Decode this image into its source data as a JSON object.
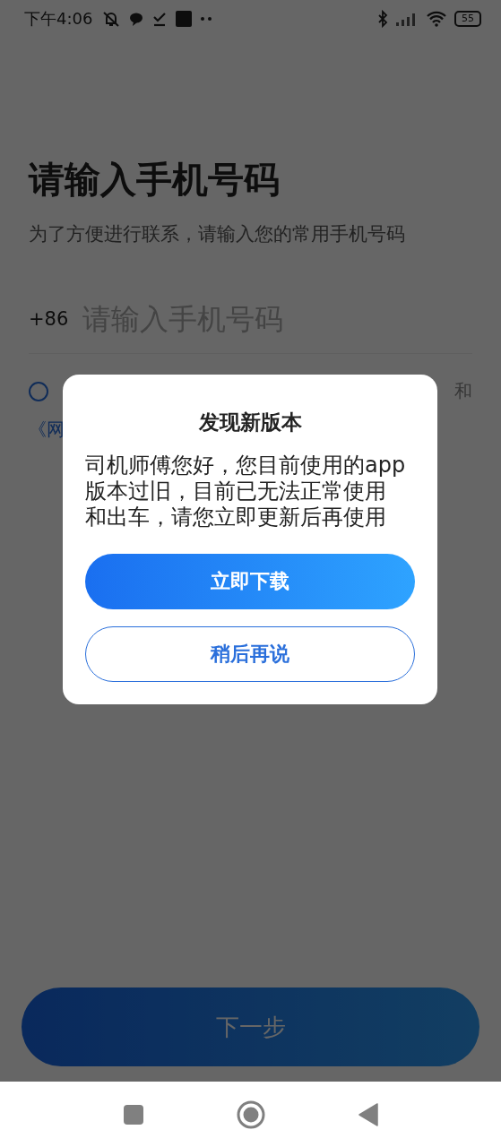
{
  "status_bar": {
    "time": "下午4:06",
    "battery": "55"
  },
  "title": "请输入手机号码",
  "subtitle": "为了方便进行联系，请输入您的常用手机号码",
  "phone": {
    "prefix": "+86",
    "placeholder": "请输入手机号码"
  },
  "agreement": {
    "checked": false,
    "tail": "和",
    "second_line": "《网"
  },
  "next_button": "下一步",
  "dialog": {
    "title": "发现新版本",
    "message": "司机师傅您好，您目前使用的app版本过旧，目前已无法正常使用和出车，请您立即更新后再使用",
    "buttons": [
      {
        "kind": "primary",
        "label": "立即下载"
      },
      {
        "kind": "secondary",
        "label": "稍后再说"
      }
    ]
  }
}
